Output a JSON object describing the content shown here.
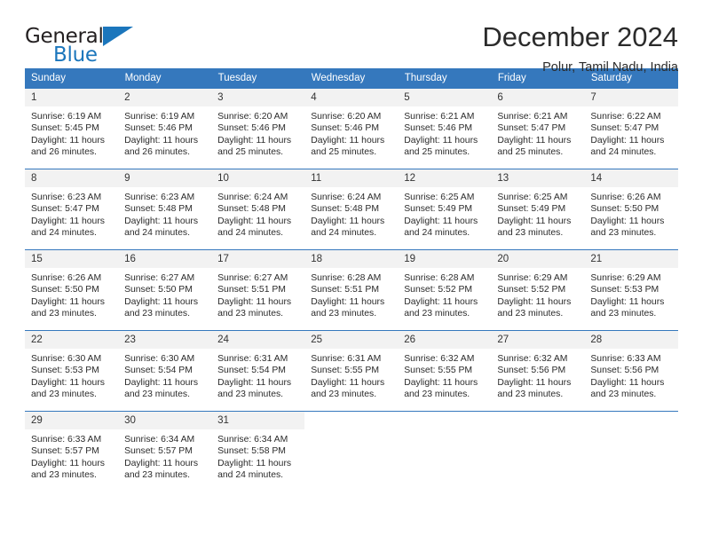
{
  "logo": {
    "word_top": "General",
    "word_bottom": "Blue",
    "triangle_icon": "blue-triangle-icon",
    "accent_color": "#1b76bc"
  },
  "header": {
    "title": "December 2024",
    "subtitle": "Polur, Tamil Nadu, India"
  },
  "calendar": {
    "header_color": "#3578bd",
    "weekday_headers": [
      "Sunday",
      "Monday",
      "Tuesday",
      "Wednesday",
      "Thursday",
      "Friday",
      "Saturday"
    ],
    "labels": {
      "sunrise": "Sunrise:",
      "sunset": "Sunset:",
      "daylight": "Daylight:"
    },
    "weeks": [
      [
        {
          "day": "1",
          "sunrise": "Sunrise: 6:19 AM",
          "sunset": "Sunset: 5:45 PM",
          "daylight_line1": "Daylight: 11 hours",
          "daylight_line2": "and 26 minutes."
        },
        {
          "day": "2",
          "sunrise": "Sunrise: 6:19 AM",
          "sunset": "Sunset: 5:46 PM",
          "daylight_line1": "Daylight: 11 hours",
          "daylight_line2": "and 26 minutes."
        },
        {
          "day": "3",
          "sunrise": "Sunrise: 6:20 AM",
          "sunset": "Sunset: 5:46 PM",
          "daylight_line1": "Daylight: 11 hours",
          "daylight_line2": "and 25 minutes."
        },
        {
          "day": "4",
          "sunrise": "Sunrise: 6:20 AM",
          "sunset": "Sunset: 5:46 PM",
          "daylight_line1": "Daylight: 11 hours",
          "daylight_line2": "and 25 minutes."
        },
        {
          "day": "5",
          "sunrise": "Sunrise: 6:21 AM",
          "sunset": "Sunset: 5:46 PM",
          "daylight_line1": "Daylight: 11 hours",
          "daylight_line2": "and 25 minutes."
        },
        {
          "day": "6",
          "sunrise": "Sunrise: 6:21 AM",
          "sunset": "Sunset: 5:47 PM",
          "daylight_line1": "Daylight: 11 hours",
          "daylight_line2": "and 25 minutes."
        },
        {
          "day": "7",
          "sunrise": "Sunrise: 6:22 AM",
          "sunset": "Sunset: 5:47 PM",
          "daylight_line1": "Daylight: 11 hours",
          "daylight_line2": "and 24 minutes."
        }
      ],
      [
        {
          "day": "8",
          "sunrise": "Sunrise: 6:23 AM",
          "sunset": "Sunset: 5:47 PM",
          "daylight_line1": "Daylight: 11 hours",
          "daylight_line2": "and 24 minutes."
        },
        {
          "day": "9",
          "sunrise": "Sunrise: 6:23 AM",
          "sunset": "Sunset: 5:48 PM",
          "daylight_line1": "Daylight: 11 hours",
          "daylight_line2": "and 24 minutes."
        },
        {
          "day": "10",
          "sunrise": "Sunrise: 6:24 AM",
          "sunset": "Sunset: 5:48 PM",
          "daylight_line1": "Daylight: 11 hours",
          "daylight_line2": "and 24 minutes."
        },
        {
          "day": "11",
          "sunrise": "Sunrise: 6:24 AM",
          "sunset": "Sunset: 5:48 PM",
          "daylight_line1": "Daylight: 11 hours",
          "daylight_line2": "and 24 minutes."
        },
        {
          "day": "12",
          "sunrise": "Sunrise: 6:25 AM",
          "sunset": "Sunset: 5:49 PM",
          "daylight_line1": "Daylight: 11 hours",
          "daylight_line2": "and 24 minutes."
        },
        {
          "day": "13",
          "sunrise": "Sunrise: 6:25 AM",
          "sunset": "Sunset: 5:49 PM",
          "daylight_line1": "Daylight: 11 hours",
          "daylight_line2": "and 23 minutes."
        },
        {
          "day": "14",
          "sunrise": "Sunrise: 6:26 AM",
          "sunset": "Sunset: 5:50 PM",
          "daylight_line1": "Daylight: 11 hours",
          "daylight_line2": "and 23 minutes."
        }
      ],
      [
        {
          "day": "15",
          "sunrise": "Sunrise: 6:26 AM",
          "sunset": "Sunset: 5:50 PM",
          "daylight_line1": "Daylight: 11 hours",
          "daylight_line2": "and 23 minutes."
        },
        {
          "day": "16",
          "sunrise": "Sunrise: 6:27 AM",
          "sunset": "Sunset: 5:50 PM",
          "daylight_line1": "Daylight: 11 hours",
          "daylight_line2": "and 23 minutes."
        },
        {
          "day": "17",
          "sunrise": "Sunrise: 6:27 AM",
          "sunset": "Sunset: 5:51 PM",
          "daylight_line1": "Daylight: 11 hours",
          "daylight_line2": "and 23 minutes."
        },
        {
          "day": "18",
          "sunrise": "Sunrise: 6:28 AM",
          "sunset": "Sunset: 5:51 PM",
          "daylight_line1": "Daylight: 11 hours",
          "daylight_line2": "and 23 minutes."
        },
        {
          "day": "19",
          "sunrise": "Sunrise: 6:28 AM",
          "sunset": "Sunset: 5:52 PM",
          "daylight_line1": "Daylight: 11 hours",
          "daylight_line2": "and 23 minutes."
        },
        {
          "day": "20",
          "sunrise": "Sunrise: 6:29 AM",
          "sunset": "Sunset: 5:52 PM",
          "daylight_line1": "Daylight: 11 hours",
          "daylight_line2": "and 23 minutes."
        },
        {
          "day": "21",
          "sunrise": "Sunrise: 6:29 AM",
          "sunset": "Sunset: 5:53 PM",
          "daylight_line1": "Daylight: 11 hours",
          "daylight_line2": "and 23 minutes."
        }
      ],
      [
        {
          "day": "22",
          "sunrise": "Sunrise: 6:30 AM",
          "sunset": "Sunset: 5:53 PM",
          "daylight_line1": "Daylight: 11 hours",
          "daylight_line2": "and 23 minutes."
        },
        {
          "day": "23",
          "sunrise": "Sunrise: 6:30 AM",
          "sunset": "Sunset: 5:54 PM",
          "daylight_line1": "Daylight: 11 hours",
          "daylight_line2": "and 23 minutes."
        },
        {
          "day": "24",
          "sunrise": "Sunrise: 6:31 AM",
          "sunset": "Sunset: 5:54 PM",
          "daylight_line1": "Daylight: 11 hours",
          "daylight_line2": "and 23 minutes."
        },
        {
          "day": "25",
          "sunrise": "Sunrise: 6:31 AM",
          "sunset": "Sunset: 5:55 PM",
          "daylight_line1": "Daylight: 11 hours",
          "daylight_line2": "and 23 minutes."
        },
        {
          "day": "26",
          "sunrise": "Sunrise: 6:32 AM",
          "sunset": "Sunset: 5:55 PM",
          "daylight_line1": "Daylight: 11 hours",
          "daylight_line2": "and 23 minutes."
        },
        {
          "day": "27",
          "sunrise": "Sunrise: 6:32 AM",
          "sunset": "Sunset: 5:56 PM",
          "daylight_line1": "Daylight: 11 hours",
          "daylight_line2": "and 23 minutes."
        },
        {
          "day": "28",
          "sunrise": "Sunrise: 6:33 AM",
          "sunset": "Sunset: 5:56 PM",
          "daylight_line1": "Daylight: 11 hours",
          "daylight_line2": "and 23 minutes."
        }
      ],
      [
        {
          "day": "29",
          "sunrise": "Sunrise: 6:33 AM",
          "sunset": "Sunset: 5:57 PM",
          "daylight_line1": "Daylight: 11 hours",
          "daylight_line2": "and 23 minutes."
        },
        {
          "day": "30",
          "sunrise": "Sunrise: 6:34 AM",
          "sunset": "Sunset: 5:57 PM",
          "daylight_line1": "Daylight: 11 hours",
          "daylight_line2": "and 23 minutes."
        },
        {
          "day": "31",
          "sunrise": "Sunrise: 6:34 AM",
          "sunset": "Sunset: 5:58 PM",
          "daylight_line1": "Daylight: 11 hours",
          "daylight_line2": "and 24 minutes."
        },
        {
          "day": "",
          "sunrise": "",
          "sunset": "",
          "daylight_line1": "",
          "daylight_line2": ""
        },
        {
          "day": "",
          "sunrise": "",
          "sunset": "",
          "daylight_line1": "",
          "daylight_line2": ""
        },
        {
          "day": "",
          "sunrise": "",
          "sunset": "",
          "daylight_line1": "",
          "daylight_line2": ""
        },
        {
          "day": "",
          "sunrise": "",
          "sunset": "",
          "daylight_line1": "",
          "daylight_line2": ""
        }
      ]
    ]
  }
}
